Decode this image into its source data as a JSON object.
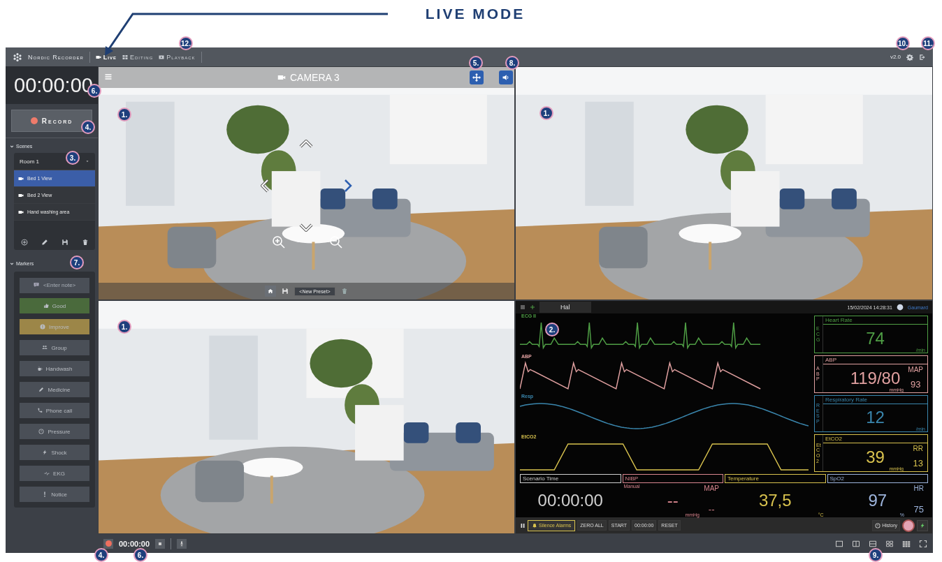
{
  "heading": "LIVE MODE",
  "app_bar": {
    "name": "Nordic Recorder",
    "modes": [
      {
        "label": "Live",
        "selected": true
      },
      {
        "label": "Editing",
        "selected": false
      },
      {
        "label": "Playback",
        "selected": false
      }
    ],
    "version": "v2.0"
  },
  "sidebar": {
    "timer": "00:00:00",
    "record": "Record",
    "scenes": {
      "title": "Scenes",
      "room": "Room 1",
      "items": [
        {
          "label": "Bed 1 View",
          "selected": true
        },
        {
          "label": "Bed 2 View",
          "selected": false
        },
        {
          "label": "Hand washing area",
          "selected": false
        }
      ]
    },
    "markers": {
      "title": "Markers",
      "note_placeholder": "<Enter note>",
      "items": [
        {
          "label": "Good",
          "color": "#4a6a3c"
        },
        {
          "label": "Improve",
          "color": "#9c8648"
        },
        {
          "label": "Group",
          "color": "#4a4f57"
        },
        {
          "label": "Handwash",
          "color": "#4a4f57"
        },
        {
          "label": "Medicine",
          "color": "#4a4f57"
        },
        {
          "label": "Phone call",
          "color": "#4a4f57"
        },
        {
          "label": "Pressure",
          "color": "#4a4f57"
        },
        {
          "label": "Shock",
          "color": "#4a4f57"
        },
        {
          "label": "EKG",
          "color": "#4a4f57"
        },
        {
          "label": "Notice",
          "color": "#4a4f57"
        }
      ]
    }
  },
  "panels": [
    {
      "kind": "camera",
      "title": "CAMERA 3",
      "preset": "<New Preset>"
    },
    {
      "kind": "picture"
    },
    {
      "kind": "picture"
    },
    {
      "kind": "monitor"
    }
  ],
  "monitor": {
    "tab": "Hal",
    "clock": "15/02/2024 14:28:31",
    "brand": "Gaumard",
    "waves": [
      {
        "label": "ECG II",
        "kind": "ecg",
        "color": "#4f9e45"
      },
      {
        "label": "ABP",
        "kind": "abp",
        "color": "#e0a0a0"
      },
      {
        "label": "Resp",
        "kind": "resp",
        "color": "#3a86ad"
      },
      {
        "label": "EtCO2",
        "kind": "co2",
        "color": "#d8c24e"
      }
    ],
    "vitals": [
      {
        "tag": "ECG",
        "title": "Heart Rate",
        "value": "74",
        "unit": "/min",
        "color": "#4f9e45"
      },
      {
        "tag": "ABP",
        "title": "ABP",
        "value": "119/80",
        "sub_label": "MAP",
        "sub_value": "93",
        "unit": "mmHg",
        "color": "#e0a0a0"
      },
      {
        "tag": "RESP",
        "title": "Respiratory Rate",
        "value": "12",
        "unit": "/min",
        "color": "#3a86ad"
      },
      {
        "tag": "EtCO2",
        "title": "EtCO2",
        "value": "39",
        "sub_label": "RR",
        "sub_value": "13",
        "unit": "mmHg",
        "color": "#d8c24e"
      }
    ],
    "readouts": [
      {
        "title": "Scenario Time",
        "value": "00:00:00",
        "color": "#cfcfcf"
      },
      {
        "title": "NIBP",
        "note": "Manual",
        "value": "--",
        "sub_label": "MAP",
        "sub_value": "--",
        "unit": "mmHg",
        "color": "#d9868f"
      },
      {
        "title": "Temperature",
        "value": "37,5",
        "unit": "°C",
        "color": "#d8c24e"
      },
      {
        "title": "SpO2",
        "value": "97",
        "sub_label": "HR",
        "sub_value": "75",
        "unit": "%",
        "color": "#9db4dc"
      }
    ],
    "toolbar": [
      "Silence Alarms",
      "ZERO ALL",
      "START",
      "00:00:00",
      "RESET"
    ],
    "history": "History"
  },
  "bottom_bar": {
    "timer": "00:00:00"
  },
  "callouts": [
    "12.",
    "10.",
    "11.",
    "5.",
    "8.",
    "6.",
    "1.",
    "1.",
    "4.",
    "3.",
    "7.",
    "1.",
    "2.",
    "4.",
    "6.",
    "9."
  ]
}
